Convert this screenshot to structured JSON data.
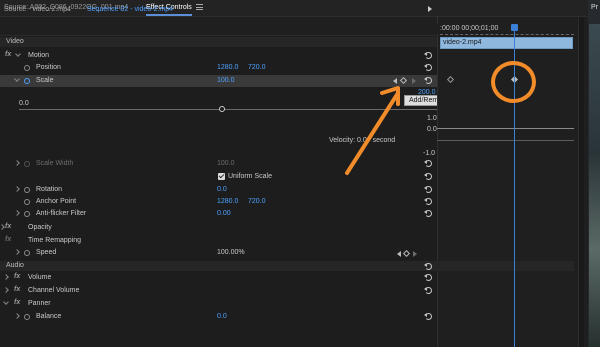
{
  "tabs": {
    "source": "Source: A002_C086_0922OG_001.mp4",
    "effect_controls": "Effect Controls"
  },
  "clipbar": {
    "source": "Source - video-2.mp4",
    "sequence": "Sequence 02 - video-2.mp4"
  },
  "sections": {
    "video": "Video",
    "audio": "Audio"
  },
  "motion": {
    "fx": "fx",
    "label": "Motion",
    "position": {
      "label": "Position",
      "x": "1280.0",
      "y": "720.0"
    },
    "scale": {
      "label": "Scale",
      "value": "100.0"
    },
    "scale_graph": {
      "min": "0.0",
      "max": "200.0",
      "velocity": "Velocity: 0.0 / second",
      "v_top": "1.0",
      "v_mid": "0.0",
      "v_bottom": "-1.0"
    },
    "scale_width": {
      "label": "Scale Width",
      "value": "100.0"
    },
    "uniform_scale": "Uniform Scale",
    "rotation": {
      "label": "Rotation",
      "value": "0.0"
    },
    "anchor_point": {
      "label": "Anchor Point",
      "x": "1280.0",
      "y": "720.0"
    },
    "anti_flicker": {
      "label": "Anti-flicker Filter",
      "value": "0.00"
    }
  },
  "opacity": {
    "fx": "fx",
    "label": "Opacity"
  },
  "time_remapping": {
    "fx": "fx",
    "label": "Time Remapping",
    "speed": {
      "label": "Speed",
      "value": "100.00%"
    }
  },
  "audio": {
    "volume": {
      "fx": "fx",
      "label": "Volume"
    },
    "channel_volume": {
      "fx": "fx",
      "label": "Channel Volume"
    },
    "panner": {
      "fx": "fx",
      "label": "Panner"
    },
    "balance": {
      "label": "Balance",
      "value": "0.0"
    }
  },
  "tooltip": "Add/Remove Keyframe",
  "timeline": {
    "timecode": ":00:00    00;00;01;00",
    "clip": "video-2.mp4"
  },
  "right_panel": {
    "label": "Pr"
  },
  "colors": {
    "accent_blue": "#4da2ff",
    "annotation_orange": "#f28c2a",
    "clip_blue": "#8fb8de"
  }
}
